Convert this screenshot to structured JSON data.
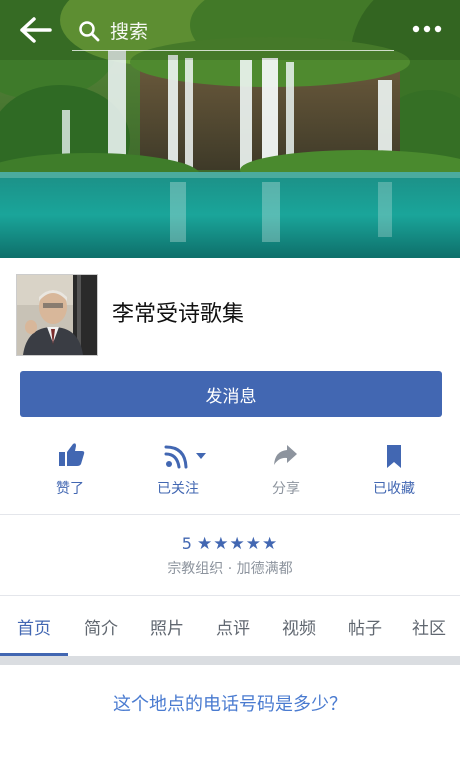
{
  "header": {
    "search_placeholder": "搜索",
    "back_icon": "back-arrow-icon",
    "more_icon": "more-dots-icon"
  },
  "page": {
    "title": "李常受诗歌集",
    "message_button": "发消息",
    "rating_value": "5",
    "stars": "★★★★★",
    "subtitle": "宗教组织 · 加德满都"
  },
  "actions": [
    {
      "label": "赞了",
      "icon": "thumbs-up-icon"
    },
    {
      "label": "已关注",
      "icon": "rss-feed-icon"
    },
    {
      "label": "分享",
      "icon": "share-arrow-icon"
    },
    {
      "label": "已收藏",
      "icon": "bookmark-icon"
    }
  ],
  "tabs": [
    "首页",
    "简介",
    "照片",
    "点评",
    "视频",
    "帖子",
    "社区"
  ],
  "question": "这个地点的电话号码是多少？",
  "colors": {
    "accent": "#4267b2",
    "muted": "#8d949e",
    "link": "#4a7bd0"
  }
}
